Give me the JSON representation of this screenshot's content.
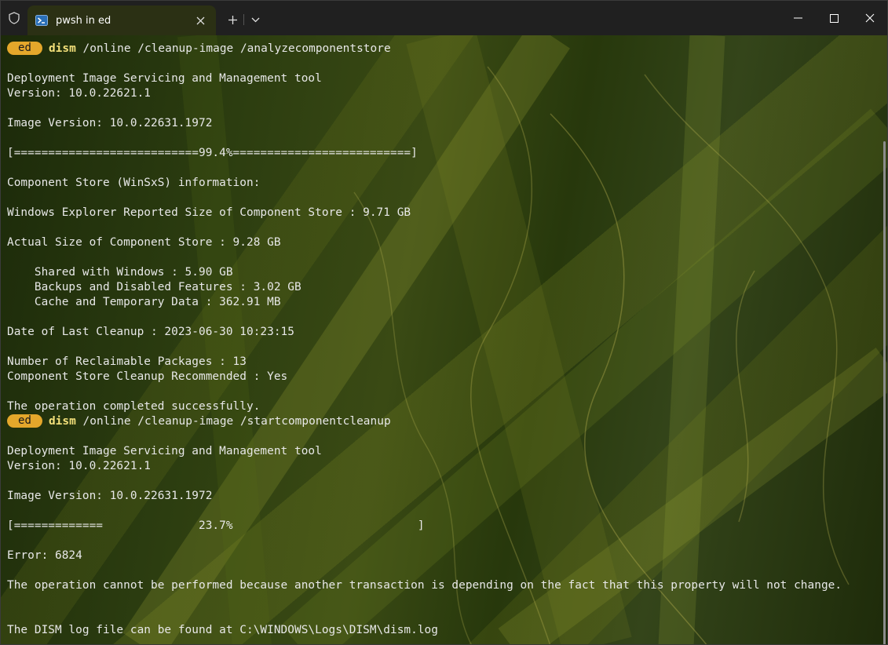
{
  "window": {
    "tab_title": "pwsh in ed",
    "new_tab_label": "+",
    "dropdown_label": "⌄",
    "close_tab_label": "✕"
  },
  "prompt": {
    "label": "ed"
  },
  "terminal": {
    "block1": {
      "cmd_name": "dism",
      "cmd_args": " /online /cleanup-image /analyzecomponentstore",
      "tool_name": "Deployment Image Servicing and Management tool",
      "version": "Version: 10.0.22621.1",
      "image_version": "Image Version: 10.0.22631.1972",
      "progress": "[===========================99.4%==========================]",
      "store_info": "Component Store (WinSxS) information:",
      "explorer_size": "Windows Explorer Reported Size of Component Store : 9.71 GB",
      "actual_size": "Actual Size of Component Store : 9.28 GB",
      "shared": "    Shared with Windows : 5.90 GB",
      "backups": "    Backups and Disabled Features : 3.02 GB",
      "cache": "    Cache and Temporary Data : 362.91 MB",
      "last_cleanup": "Date of Last Cleanup : 2023-06-30 10:23:15",
      "reclaimable": "Number of Reclaimable Packages : 13",
      "recommended": "Component Store Cleanup Recommended : Yes",
      "completed": "The operation completed successfully."
    },
    "block2": {
      "cmd_name": "dism",
      "cmd_args": " /online /cleanup-image /startcomponentcleanup",
      "tool_name": "Deployment Image Servicing and Management tool",
      "version": "Version: 10.0.22621.1",
      "image_version": "Image Version: 10.0.22631.1972",
      "progress": "[=============              23.7%                           ]",
      "error": "Error: 6824",
      "error_msg": "The operation cannot be performed because another transaction is depending on the fact that this property will not change.",
      "log": "The DISM log file can be found at C:\\WINDOWS\\Logs\\DISM\\dism.log"
    }
  },
  "colors": {
    "prompt_badge": "#e4a72b",
    "command": "#f3e07a",
    "text": "#e8e8e8"
  }
}
